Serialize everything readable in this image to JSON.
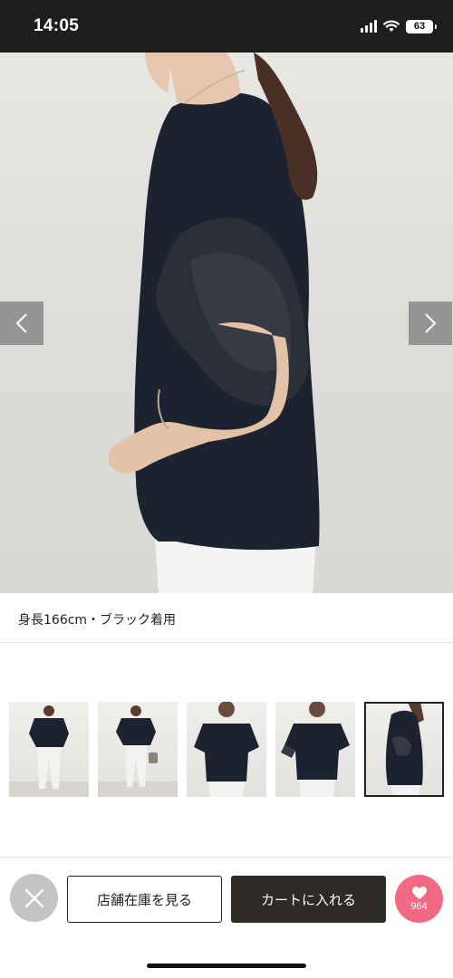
{
  "status_bar": {
    "time": "14:05",
    "battery": "63",
    "icons": [
      "signal-icon",
      "wifi-icon",
      "battery-icon"
    ]
  },
  "gallery": {
    "caption": "身長166cm・ブラック着用",
    "prev_icon": "chevron-left-icon",
    "next_icon": "chevron-right-icon",
    "thumbnail_count": 5,
    "active_thumbnail": 5
  },
  "actions": {
    "close_icon": "close-icon",
    "store_stock_label": "店舗在庫を見る",
    "add_to_cart_label": "カートに入れる",
    "favorite_icon": "heart-icon",
    "favorite_count": "964"
  },
  "colors": {
    "status_bar_bg": "#1f1e1c",
    "cart_button_bg": "#2e2a25",
    "favorite_bg": "#f06a83",
    "close_bg": "#c4c4c4"
  }
}
